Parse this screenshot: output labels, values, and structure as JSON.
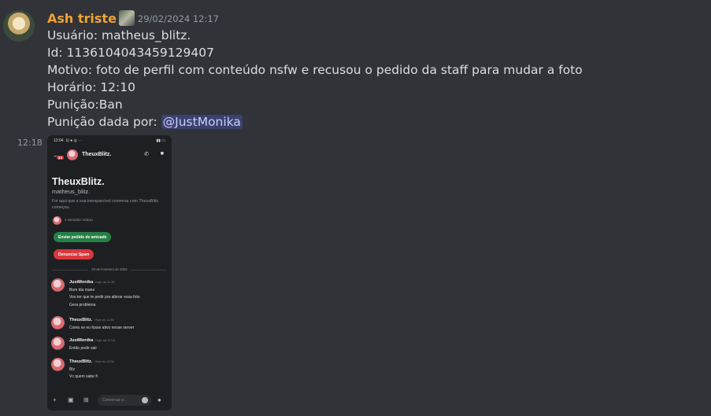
{
  "message": {
    "author": "Ash triste",
    "timestamp": "29/02/2024 12:17",
    "lines": {
      "usuario": "Usuário: matheus_blitz.",
      "id": "Id: 1136104043459129407",
      "motivo": "Motivo: foto de perfil com conteúdo nsfw e recusou o pedido da staff para mudar a foto",
      "horario": "Horário: 12:10",
      "punicao": "Punição:Ban",
      "dada_por_label": "Punição dada por:",
      "mention": "@JustMonika"
    }
  },
  "attachment": {
    "time": "12:18",
    "status_time": "12:04",
    "back_badge": "24",
    "header_name": "TheuxBlitz.",
    "profile_name": "TheuxBlitz.",
    "profile_handle": "matheus_blitz.",
    "description": "Foi aqui que a sua inesquecível conversa com TheuxBlitz. começou.",
    "mutual": "1 servidor mútuo",
    "friend_button": "Enviar pedido de amizade",
    "spam_button": "Denunciar Spam",
    "date_divider": "29 de fevereiro de 2024",
    "messages": [
      {
        "name": "JustMonika",
        "time": "Hoje às 11:30",
        "lines": [
          "Bom dia mano",
          "Vou ter que te pedir pra alterar essa foto",
          "Gera problema"
        ]
      },
      {
        "name": "TheuxBlitz.",
        "time": "Hoje às 11:56",
        "lines": [
          "Como se eu fosse ativo nesse server"
        ]
      },
      {
        "name": "JustMonika",
        "time": "Hoje às 12:04",
        "lines": [
          "Então pode sair"
        ]
      },
      {
        "name": "TheuxBlitz.",
        "time": "Hoje às 12:04",
        "lines": [
          "Blz",
          "Vc quem sabe fi"
        ]
      }
    ],
    "input_placeholder": "Conversar e..."
  }
}
